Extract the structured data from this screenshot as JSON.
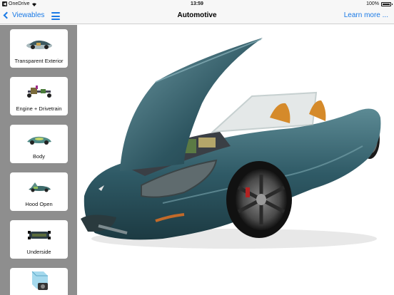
{
  "status_bar": {
    "back_app": "OneDrive",
    "time": "13:59",
    "battery": "100%"
  },
  "nav": {
    "back_label": "Viewables",
    "title": "Automotive",
    "learn_more": "Learn more ..."
  },
  "viewables": [
    {
      "label": "Transparent Exterior",
      "icon": "car-transparent-thumbnail"
    },
    {
      "label": "Engine + Drivetrain",
      "icon": "drivetrain-thumbnail"
    },
    {
      "label": "Body",
      "icon": "car-body-thumbnail"
    },
    {
      "label": "Hood Open",
      "icon": "car-hood-open-thumbnail"
    },
    {
      "label": "Underside",
      "icon": "car-underside-thumbnail"
    },
    {
      "label": "",
      "icon": "camera-cube-thumbnail"
    }
  ],
  "colors": {
    "accent": "#1a7ae6",
    "sidebar": "#8e8e8e",
    "car_body": "#2f5a66"
  }
}
